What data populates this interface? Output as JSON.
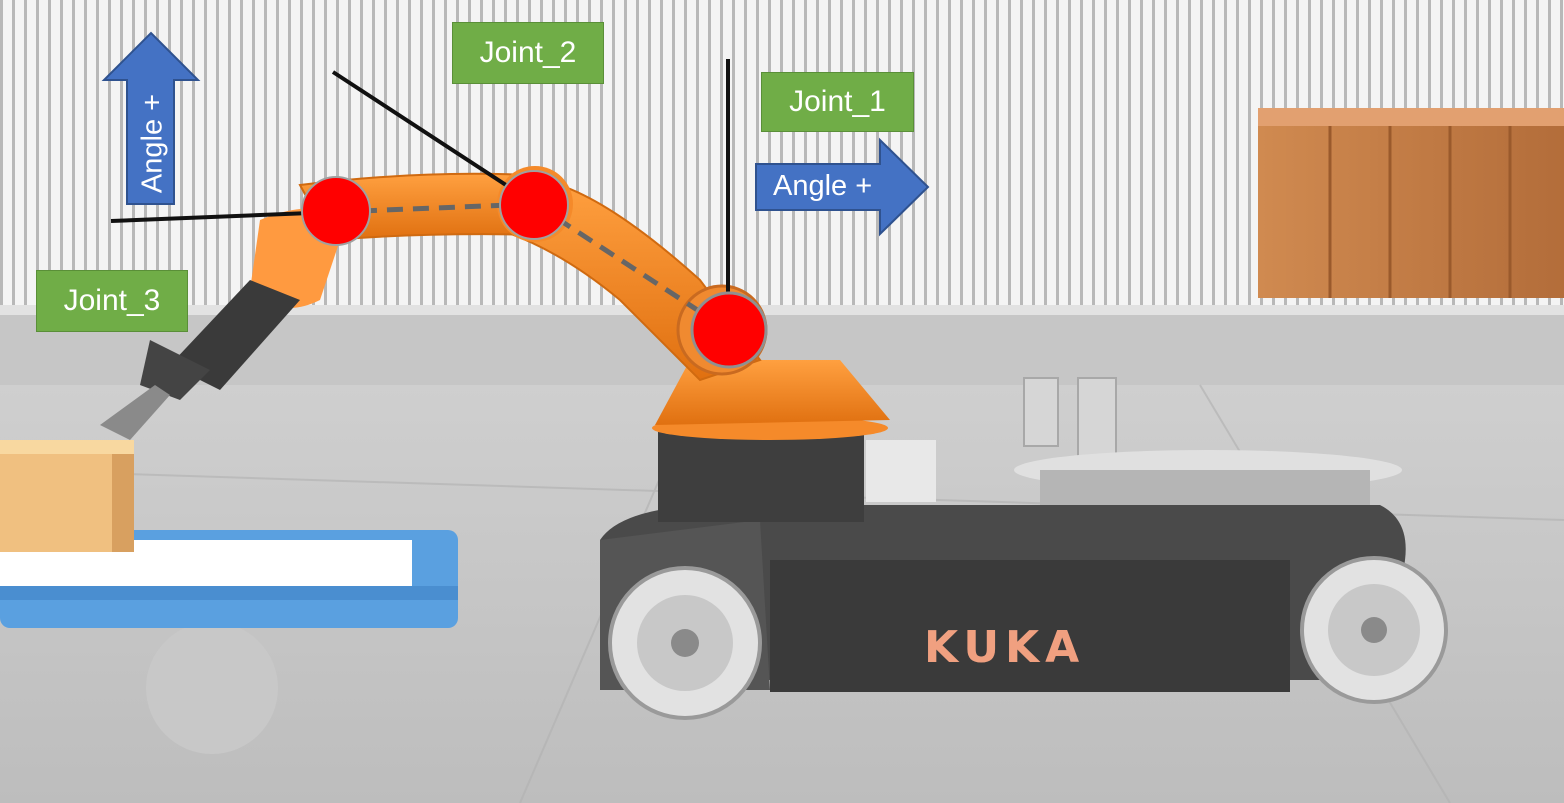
{
  "labels": {
    "joint_1": "Joint_1",
    "joint_2": "Joint_2",
    "joint_3": "Joint_3"
  },
  "arrows": {
    "horizontal": "Angle +",
    "vertical": "Angle +"
  },
  "branding": {
    "logo_text": "KUKA"
  },
  "colors": {
    "label_fill": "#70ad47",
    "arrow_fill": "#4472c4",
    "joint_marker": "#ff0000",
    "robot_orange": "#f58a2a",
    "logo_text": "#f0a080"
  }
}
